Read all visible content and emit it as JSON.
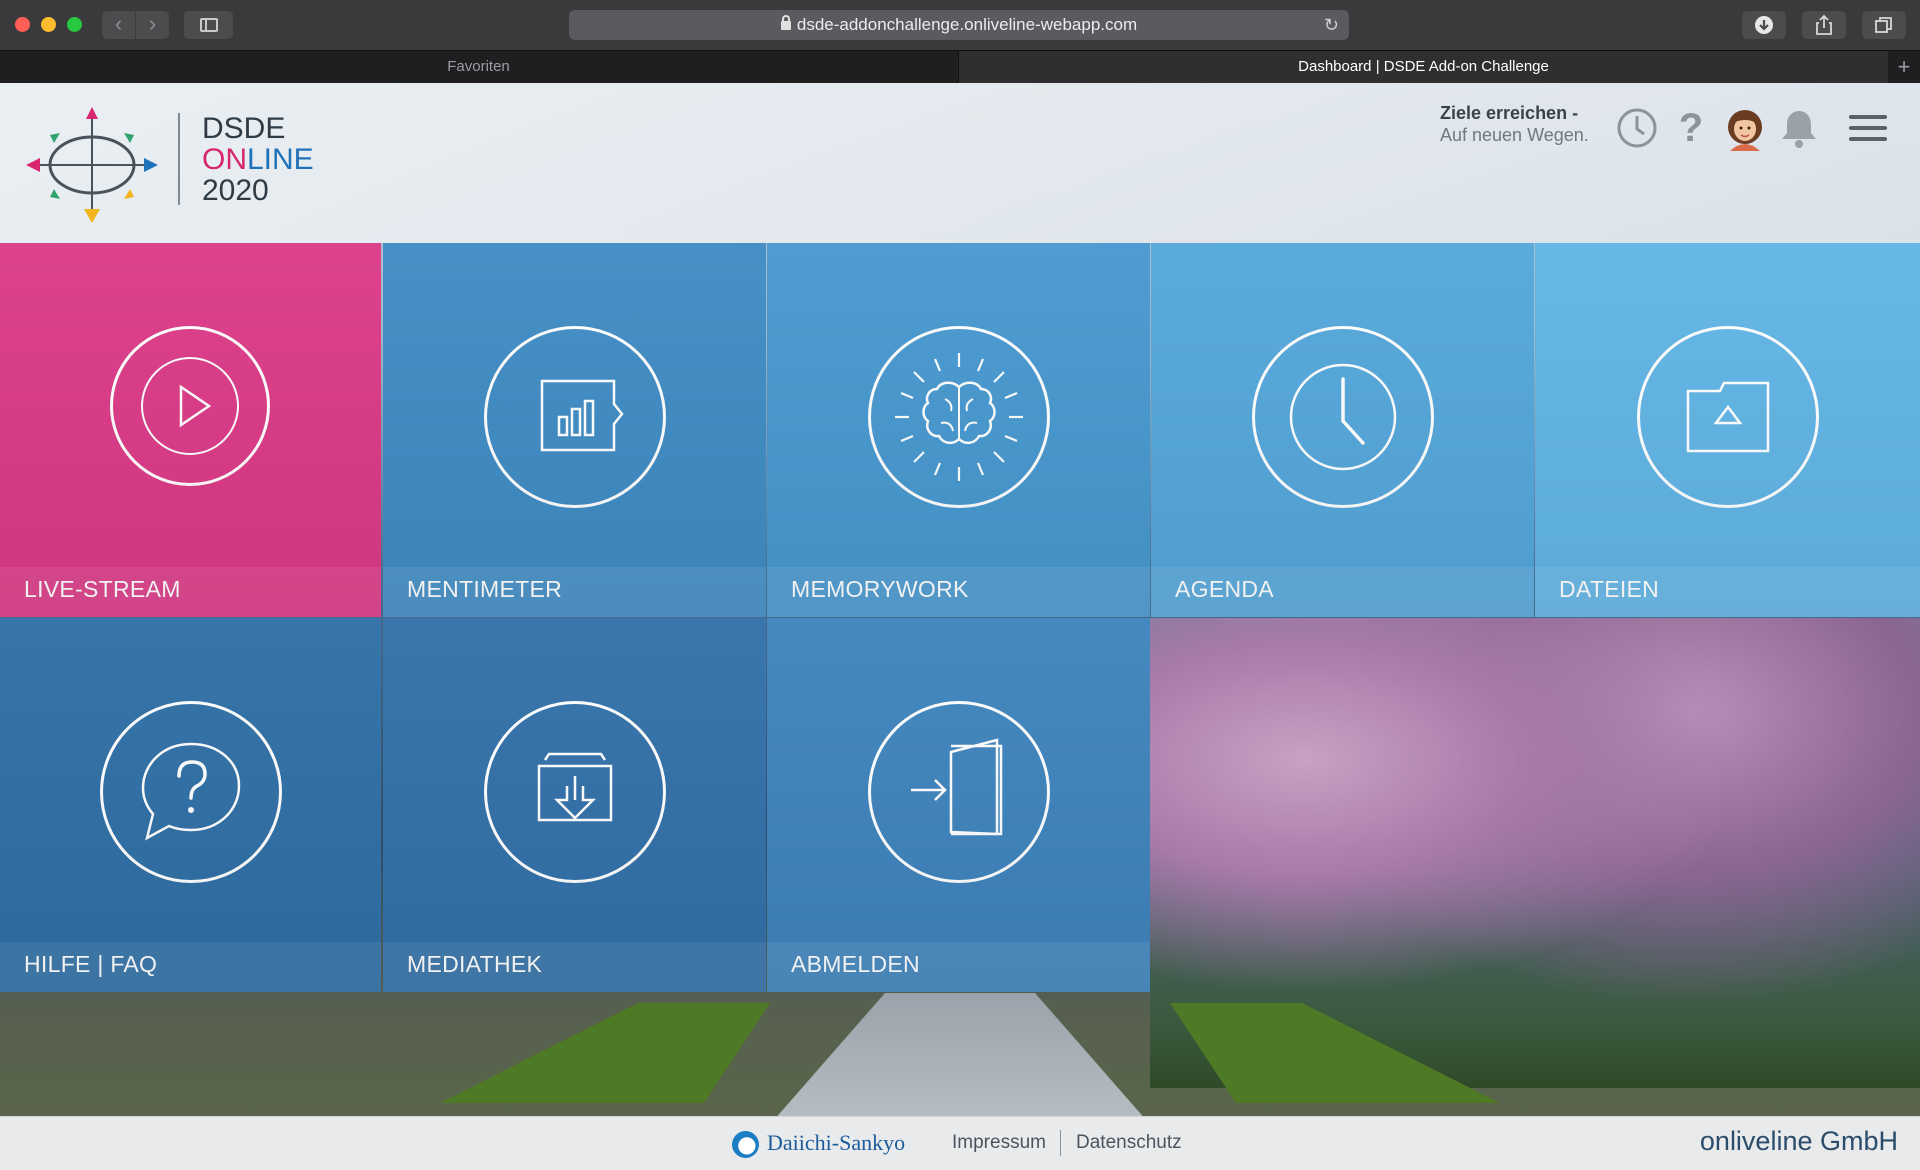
{
  "browser": {
    "url": "dsde-addonchallenge.onliveline-webapp.com",
    "tabs": [
      {
        "label": "Favoriten"
      },
      {
        "label": "Dashboard | DSDE Add-on Challenge"
      }
    ],
    "new_tab_label": "+"
  },
  "header": {
    "brand": {
      "line1": "DSDE",
      "line2_a": "ON",
      "line2_b": "LINE",
      "line3": "2020"
    },
    "slogan": {
      "title": "Ziele erreichen -",
      "subtitle": "Auf neuen Wegen."
    },
    "icons": [
      "clock-icon",
      "help-icon",
      "avatar",
      "bell-icon",
      "menu-icon"
    ],
    "help_glyph": "?"
  },
  "tiles": [
    {
      "label": "LIVE-STREAM",
      "icon": "play-icon",
      "color": "#dc3a87"
    },
    {
      "label": "MENTIMETER",
      "icon": "chart-icon",
      "color": "#3f8cc5"
    },
    {
      "label": "MEMORYWORK",
      "icon": "brain-icon",
      "color": "#4798d0"
    },
    {
      "label": "AGENDA",
      "icon": "clock-icon",
      "color": "#54a7db"
    },
    {
      "label": "DATEIEN",
      "icon": "folder-icon",
      "color": "#61b5e6"
    },
    {
      "label": "HILFE | FAQ",
      "icon": "question-bubble-icon",
      "color": "#2f6fa6"
    },
    {
      "label": "MEDIATHEK",
      "icon": "archive-icon",
      "color": "#3271a9"
    },
    {
      "label": "ABMELDEN",
      "icon": "logout-door-icon",
      "color": "#3e84bd"
    }
  ],
  "footer": {
    "partner": "Daiichi-Sankyo",
    "links": [
      {
        "label": "Impressum"
      },
      {
        "label": "Datenschutz"
      }
    ],
    "company": "onliveline GmbH"
  }
}
